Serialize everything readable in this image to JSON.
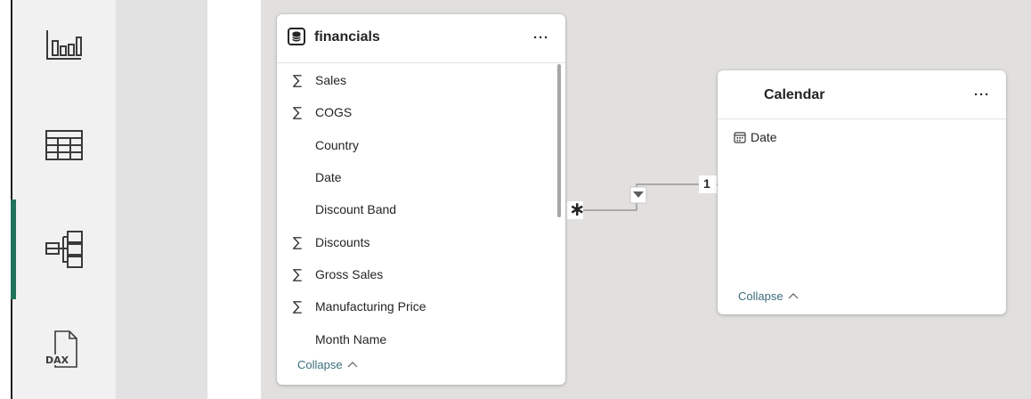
{
  "theme": {
    "accent": "#21735a",
    "link": "#3d6d7c"
  },
  "view_rail": {
    "items": [
      {
        "icon": "report-view-icon",
        "active": false
      },
      {
        "icon": "table-view-icon",
        "active": false
      },
      {
        "icon": "model-view-icon",
        "active": true
      },
      {
        "icon": "dax-query-view-icon",
        "active": false
      }
    ]
  },
  "financials_table": {
    "title": "financials",
    "more_label": "···",
    "sigma": "∑",
    "fields": [
      {
        "label": "Sales",
        "aggregated": true
      },
      {
        "label": "COGS",
        "aggregated": true
      },
      {
        "label": "Country",
        "aggregated": false
      },
      {
        "label": "Date",
        "aggregated": false
      },
      {
        "label": "Discount Band",
        "aggregated": false
      },
      {
        "label": "Discounts",
        "aggregated": true
      },
      {
        "label": "Gross Sales",
        "aggregated": true
      },
      {
        "label": "Manufacturing Price",
        "aggregated": true
      },
      {
        "label": "Month Name",
        "aggregated": false
      }
    ],
    "collapse_label": "Collapse",
    "collapse_chevron": "^"
  },
  "calendar_table": {
    "title": "Calendar",
    "more_label": "···",
    "fields": [
      {
        "label": "Date",
        "icon": "calendar-icon"
      }
    ],
    "collapse_label": "Collapse",
    "collapse_chevron": "^"
  },
  "relationship": {
    "many_marker": "∗",
    "one_marker": "1",
    "filter_direction": "single"
  }
}
